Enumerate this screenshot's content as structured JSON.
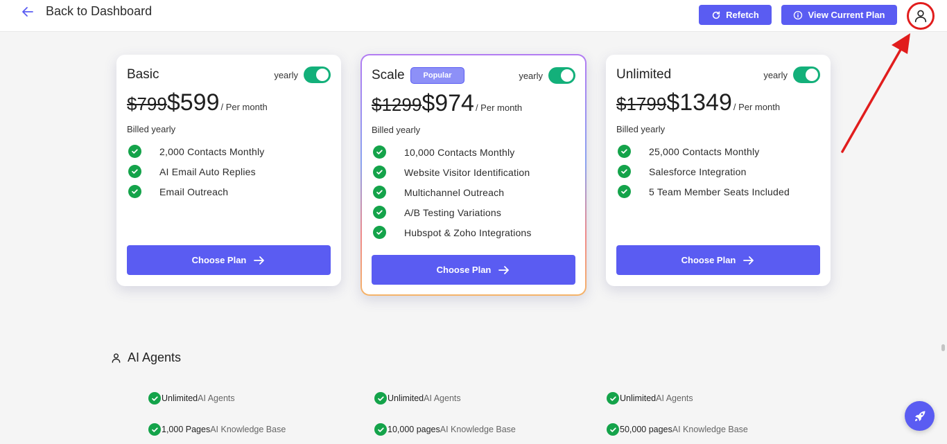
{
  "header": {
    "back_label": "Back to Dashboard",
    "refetch_label": "Refetch",
    "view_plan_label": "View Current Plan"
  },
  "plans": [
    {
      "name": "Basic",
      "toggle_label": "yearly",
      "old_price": "$799",
      "new_price": "$599",
      "per": "/ Per month",
      "billed": "Billed yearly",
      "features": [
        "2,000 Contacts Monthly",
        "AI Email Auto Replies",
        "Email Outreach"
      ],
      "cta": "Choose Plan"
    },
    {
      "name": "Scale",
      "badge": "Popular",
      "toggle_label": "yearly",
      "old_price": "$1299",
      "new_price": "$974",
      "per": "/ Per month",
      "billed": "Billed yearly",
      "features": [
        "10,000 Contacts Monthly",
        "Website Visitor Identification",
        "Multichannel Outreach",
        "A/B Testing Variations",
        "Hubspot & Zoho Integrations"
      ],
      "cta": "Choose Plan"
    },
    {
      "name": "Unlimited",
      "toggle_label": "yearly",
      "old_price": "$1799",
      "new_price": "$1349",
      "per": "/ Per month",
      "billed": "Billed yearly",
      "features": [
        "25,000 Contacts Monthly",
        "Salesforce Integration",
        "5 Team Member Seats Included"
      ],
      "cta": "Choose Plan"
    }
  ],
  "ai_agents": {
    "title": "AI Agents",
    "rows": [
      [
        {
          "strong": "Unlimited",
          "muted": "AI Agents"
        },
        {
          "strong": "Unlimited",
          "muted": "AI Agents"
        },
        {
          "strong": "Unlimited",
          "muted": "AI Agents"
        }
      ],
      [
        {
          "strong": "1,000 Pages",
          "muted": "AI Knowledge Base"
        },
        {
          "strong": "10,000 pages",
          "muted": "AI Knowledge Base"
        },
        {
          "strong": "50,000 pages",
          "muted": "AI Knowledge Base"
        }
      ]
    ]
  },
  "colors": {
    "primary": "#5a5cf2",
    "check": "#14a34a",
    "toggle_on": "#13b07a",
    "annotation": "#e11d1d"
  }
}
